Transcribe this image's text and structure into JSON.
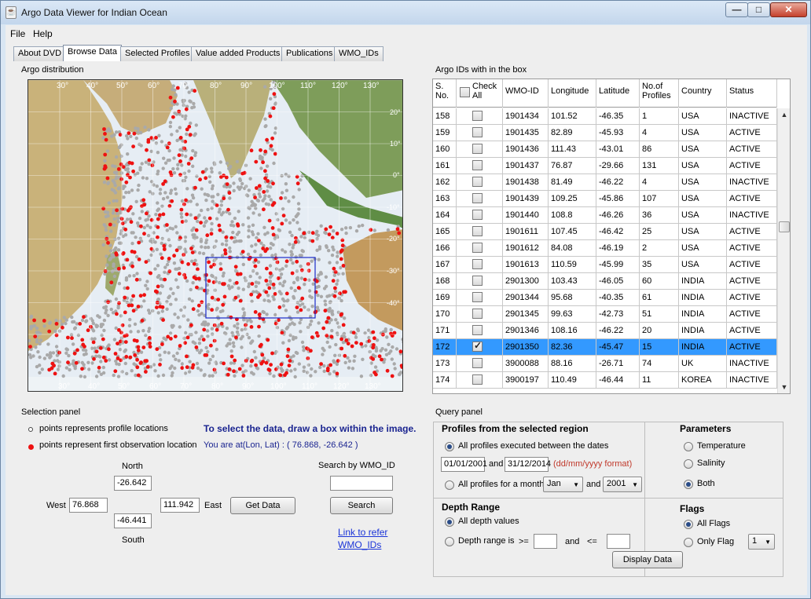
{
  "window": {
    "title": "Argo Data Viewer for Indian Ocean",
    "min_glyph": "—",
    "max_glyph": "□",
    "close_glyph": "✕"
  },
  "menu": {
    "file": "File",
    "help": "Help"
  },
  "tabs": [
    "About DVD",
    "Browse Data",
    "Selected Profiles",
    "Value added Products",
    "Publications",
    "WMO_IDs"
  ],
  "map": {
    "label": "Argo distribution",
    "lon_ticks": [
      "30°",
      "40°",
      "50°",
      "60°",
      "70°",
      "80°",
      "90°",
      "100°",
      "110°",
      "120°",
      "130°"
    ],
    "lat_ticks": [
      "20°",
      "10°",
      "0°",
      "-10°",
      "-20°",
      "-30°",
      "-40°"
    ],
    "profile_color": "#a9a9a9",
    "first_obs_color": "#ee1111",
    "box_color": "#1a2bc9"
  },
  "table": {
    "label": "Argo IDs with in the box",
    "headers": {
      "sno": "S. No.",
      "check": "Check All",
      "wmo": "WMO-ID",
      "lon": "Longitude",
      "lat": "Latitude",
      "nprof": "No.of Profiles",
      "country": "Country",
      "status": "Status"
    },
    "rows": [
      {
        "sno": "158",
        "wmo": "1901434",
        "lon": "101.52",
        "lat": "-46.35",
        "nprof": "1",
        "country": "USA",
        "status": "INACTIVE",
        "checked": false
      },
      {
        "sno": "159",
        "wmo": "1901435",
        "lon": "82.89",
        "lat": "-45.93",
        "nprof": "4",
        "country": "USA",
        "status": "ACTIVE",
        "checked": false
      },
      {
        "sno": "160",
        "wmo": "1901436",
        "lon": "111.43",
        "lat": "-43.01",
        "nprof": "86",
        "country": "USA",
        "status": "ACTIVE",
        "checked": false
      },
      {
        "sno": "161",
        "wmo": "1901437",
        "lon": "76.87",
        "lat": "-29.66",
        "nprof": "131",
        "country": "USA",
        "status": "ACTIVE",
        "checked": false
      },
      {
        "sno": "162",
        "wmo": "1901438",
        "lon": "81.49",
        "lat": "-46.22",
        "nprof": "4",
        "country": "USA",
        "status": "INACTIVE",
        "checked": false
      },
      {
        "sno": "163",
        "wmo": "1901439",
        "lon": "109.25",
        "lat": "-45.86",
        "nprof": "107",
        "country": "USA",
        "status": "ACTIVE",
        "checked": false
      },
      {
        "sno": "164",
        "wmo": "1901440",
        "lon": "108.8",
        "lat": "-46.26",
        "nprof": "36",
        "country": "USA",
        "status": "INACTIVE",
        "checked": false
      },
      {
        "sno": "165",
        "wmo": "1901611",
        "lon": "107.45",
        "lat": "-46.42",
        "nprof": "25",
        "country": "USA",
        "status": "ACTIVE",
        "checked": false
      },
      {
        "sno": "166",
        "wmo": "1901612",
        "lon": "84.08",
        "lat": "-46.19",
        "nprof": "2",
        "country": "USA",
        "status": "ACTIVE",
        "checked": false
      },
      {
        "sno": "167",
        "wmo": "1901613",
        "lon": "110.59",
        "lat": "-45.99",
        "nprof": "35",
        "country": "USA",
        "status": "ACTIVE",
        "checked": false
      },
      {
        "sno": "168",
        "wmo": "2901300",
        "lon": "103.43",
        "lat": "-46.05",
        "nprof": "60",
        "country": "INDIA",
        "status": "ACTIVE",
        "checked": false
      },
      {
        "sno": "169",
        "wmo": "2901344",
        "lon": "95.68",
        "lat": "-40.35",
        "nprof": "61",
        "country": "INDIA",
        "status": "ACTIVE",
        "checked": false
      },
      {
        "sno": "170",
        "wmo": "2901345",
        "lon": "99.63",
        "lat": "-42.73",
        "nprof": "51",
        "country": "INDIA",
        "status": "ACTIVE",
        "checked": false
      },
      {
        "sno": "171",
        "wmo": "2901346",
        "lon": "108.16",
        "lat": "-46.22",
        "nprof": "20",
        "country": "INDIA",
        "status": "ACTIVE",
        "checked": false
      },
      {
        "sno": "172",
        "wmo": "2901350",
        "lon": "82.36",
        "lat": "-45.47",
        "nprof": "15",
        "country": "INDIA",
        "status": "ACTIVE",
        "checked": true
      },
      {
        "sno": "173",
        "wmo": "3900088",
        "lon": "88.16",
        "lat": "-26.71",
        "nprof": "74",
        "country": "UK",
        "status": "INACTIVE",
        "checked": false
      },
      {
        "sno": "174",
        "wmo": "3900197",
        "lon": "110.49",
        "lat": "-46.44",
        "nprof": "11",
        "country": "KOREA",
        "status": "INACTIVE",
        "checked": false
      }
    ],
    "selected_row": 14,
    "selected_color": "#3399ff"
  },
  "selection": {
    "label": "Selection panel",
    "legend_profile": "points represents profile locations",
    "legend_first": "points represent first observation location",
    "instruction": "To select the data, draw a box within the image.",
    "position": "You are at(Lon, Lat) : ( 76.868, -26.642 )",
    "north_label": "North",
    "south_label": "South",
    "west_label": "West",
    "east_label": "East",
    "north": "-26.642",
    "south": "-46.441",
    "west": "76.868",
    "east": "111.942",
    "get_data": "Get Data",
    "search_label": "Search by WMO_ID",
    "search_value": "",
    "search_button": "Search",
    "link_line1": "Link to refer",
    "link_line2": "WMO_IDs"
  },
  "query": {
    "label": "Query panel",
    "profiles_title": "Profiles from the selected region",
    "opt_dates": "All profiles executed between the dates",
    "date_from": "01/01/2001",
    "and1": "and",
    "date_to": "31/12/2014",
    "date_hint": "(dd/mm/yyyy format)",
    "opt_month": "All profiles for a month",
    "month": "Jan",
    "and2": "and",
    "year": "2001",
    "parameters_title": "Parameters",
    "param_temp": "Temperature",
    "param_sal": "Salinity",
    "param_both": "Both",
    "depth_title": "Depth Range",
    "opt_all_depth": "All depth values",
    "opt_depth_range": "Depth range is",
    "ge": ">=",
    "and3": "and",
    "le": "<=",
    "depth_min": "",
    "depth_max": "",
    "flags_title": "Flags",
    "flag_all": "All Flags",
    "flag_only": "Only Flag",
    "flag_value": "1",
    "display_button": "Display Data"
  }
}
